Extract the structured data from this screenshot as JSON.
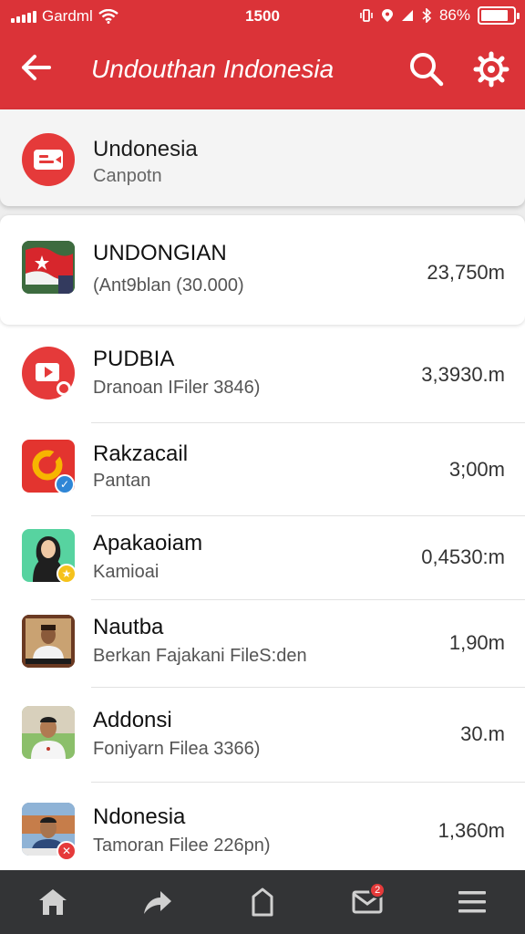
{
  "status_bar": {
    "carrier": "Gardml",
    "time": "1500",
    "battery": "86%",
    "battery_level": 0.86
  },
  "app_bar": {
    "title": "Undouthan Indonesia",
    "back_icon": "arrow-left-icon",
    "search_icon": "search-icon",
    "settings_icon": "gear-icon"
  },
  "top_card": {
    "name": "Undonesia",
    "subtitle": "Canpotn"
  },
  "items": [
    {
      "name": "UNDONGIAN",
      "subtitle": "(Ant9blan (30.000)",
      "size": "23,750m",
      "icon": "flag-thumbnail"
    },
    {
      "name": "PUDBIA",
      "subtitle": "Dranoan ⁠IFiler 3846)",
      "size": "3,3930.m",
      "icon": "video-play-icon"
    },
    {
      "name": "Rakzacail",
      "subtitle": "Pantan",
      "size": "3;00m",
      "icon": "app-logo-icon"
    },
    {
      "name": "Apakaoiam",
      "subtitle": "Kamioai",
      "size": "0,4530:m",
      "icon": "avatar-hijab"
    },
    {
      "name": "Nautba",
      "subtitle": "Berkan Fajakani FileS:den",
      "size": "1,90m",
      "icon": "avatar-man-poster"
    },
    {
      "name": "Addonsi",
      "subtitle": "Foniyarn Filea 3366)",
      "size": "30.m",
      "icon": "avatar-man-portrait"
    },
    {
      "name": "Ndonesia",
      "subtitle": "Tamoran Filee 226pn)",
      "size": "1,360m",
      "icon": "avatar-man-building"
    }
  ],
  "bottom_nav": [
    {
      "icon": "home-icon"
    },
    {
      "icon": "share-icon"
    },
    {
      "icon": "bag-icon"
    },
    {
      "icon": "inbox-icon",
      "badge": "2"
    },
    {
      "icon": "menu-icon"
    }
  ],
  "colors": {
    "primary": "#db3338",
    "nav_bg": "#333436"
  }
}
